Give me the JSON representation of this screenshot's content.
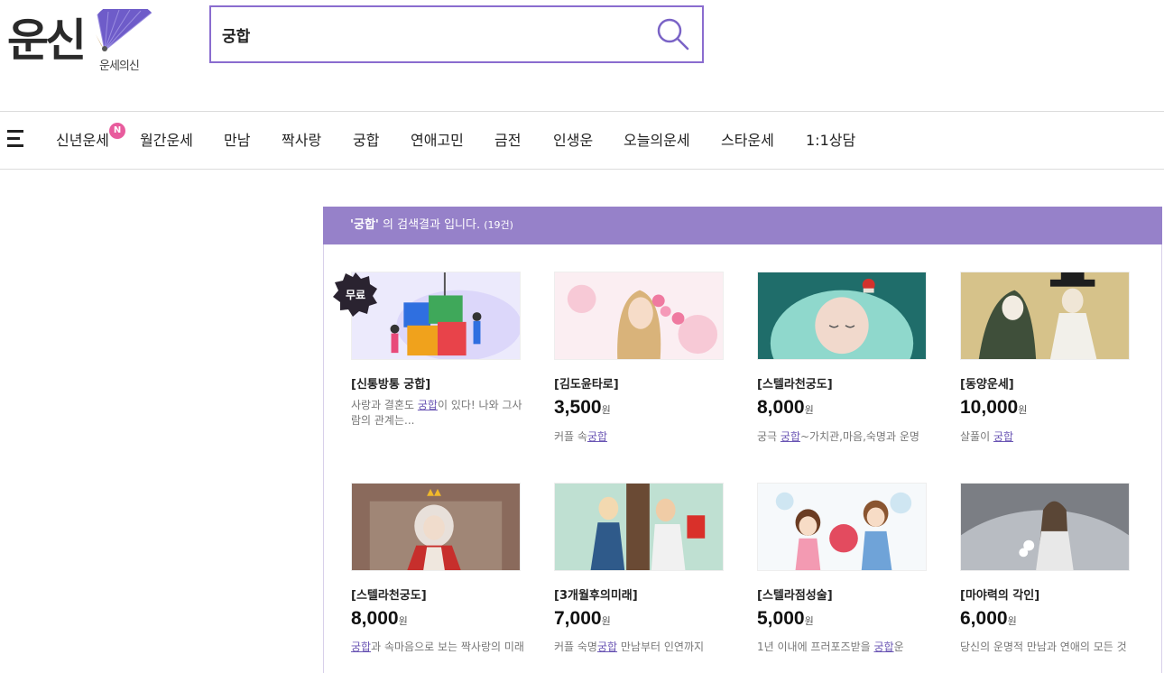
{
  "logo": {
    "main": "운신",
    "sub": "운세의신"
  },
  "search": {
    "value": "궁합"
  },
  "nav": {
    "items": [
      "신년운세",
      "월간운세",
      "만남",
      "짝사랑",
      "궁합",
      "연애고민",
      "금전",
      "인생운",
      "오늘의운세",
      "스타운세",
      "1:1상담"
    ],
    "new_badge": "N"
  },
  "result": {
    "query": "'궁합'",
    "suffix": " 의 검색결과 입니다.",
    "count": "(19건)"
  },
  "currency": "원",
  "free_badge": "무료",
  "cards": [
    {
      "title": "[신통방통 궁합]",
      "price": "",
      "desc_pre": "사랑과 결혼도 ",
      "desc_kw": "궁합",
      "desc_post": "이 있다! 나와 그사람의 관계는..."
    },
    {
      "title": "[김도윤타로]",
      "price": "3,500",
      "desc_pre": "커플 속",
      "desc_kw": "궁합",
      "desc_post": ""
    },
    {
      "title": "[스텔라천궁도]",
      "price": "8,000",
      "desc_pre": "궁극 ",
      "desc_kw": "궁합",
      "desc_post": "~가치관,마음,숙명과 운명"
    },
    {
      "title": "[동양운세]",
      "price": "10,000",
      "desc_pre": "살풀이 ",
      "desc_kw": "궁합",
      "desc_post": ""
    },
    {
      "title": "[스텔라천궁도]",
      "price": "8,000",
      "desc_pre": "",
      "desc_kw": "궁합",
      "desc_post": "과 속마음으로 보는 짝사랑의 미래"
    },
    {
      "title": "[3개월후의미래]",
      "price": "7,000",
      "desc_pre": "커플 숙명",
      "desc_kw": "궁합",
      "desc_post": " 만남부터 인연까지"
    },
    {
      "title": "[스텔라점성술]",
      "price": "5,000",
      "desc_pre": "1년 이내에 프러포즈받을 ",
      "desc_kw": "궁합",
      "desc_post": "운"
    },
    {
      "title": "[마야력의 각인]",
      "price": "6,000",
      "desc_pre": "당신의 운명적 만남과 연애의 모든 것",
      "desc_kw": "",
      "desc_post": ""
    }
  ],
  "colors": {
    "accent": "#9681c9",
    "search_border": "#8a6ccf",
    "badge": "#e85c9d",
    "link": "#6a55b4"
  }
}
